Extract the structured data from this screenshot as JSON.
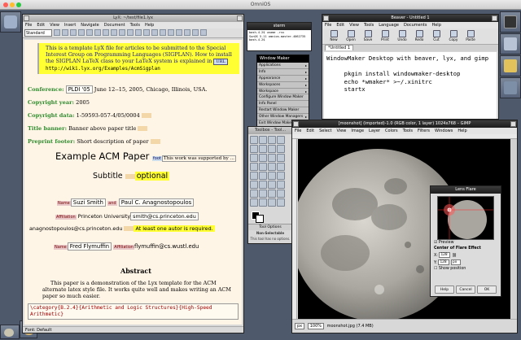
{
  "host": {
    "title": "OmniOS"
  },
  "lyx": {
    "title": "LyX: ~/test/file1.lyx",
    "menu": [
      "File",
      "Edit",
      "View",
      "Insert",
      "Navigate",
      "Document",
      "Tools",
      "Help"
    ],
    "style_select": "Standard",
    "ert_text": "This is a template LyX file for articles to be submitted to the Special Interest Group on Programming Languages (SIGPLAN). How to install the SIGPLAN LaTeX class to your LaTeX system is explained in",
    "url_label": "URL",
    "url": "http://wiki.lyx.org/Examples/AcmSigplan",
    "conference_label": "Conference:",
    "conference_name": "PLDI '05",
    "conference_value": "June 12--15, 2005, Chicago, Illinois, USA.",
    "copyright_year_label": "Copyright year:",
    "copyright_year": "2005",
    "copyright_data_label": "Copyright data:",
    "copyright_data": "1-59593-057-4/05/0004",
    "title_banner_label": "Title banner:",
    "title_banner": "Banner above paper title",
    "preprint_label": "Preprint footer:",
    "preprint": "Short description of paper",
    "paper_title": "Example ACM Paper",
    "foot_label": "foot",
    "foot_text": "This work was supported by ...",
    "subtitle": "Subtitle",
    "subtitle_optional": "optional",
    "name_label": "Name",
    "author1": "Suzi Smith",
    "and_label": "and",
    "author2": "Paul C. Anagnostopoulos",
    "affiliation_label": "Affiliation",
    "affiliation1": "Princeton University",
    "email1": "smith@cs.princeton.edu",
    "email2": "anagnostopoulos@cs.princeton.edu",
    "author_warning": "At least one autor is required.",
    "author3": "Fred Flymuffin",
    "email3": "flymuffin@cs.wustl.edu",
    "abstract_heading": "Abstract",
    "abstract_text": "This paper is a demonstration of the Lyx template for the ACM alternate latex style file. It works quite well and makes writing an ACM paper so much easier.",
    "category_code": "\\category{B.2.4}{Arithmetic and Logic Structures}{High-Speed Arithmetic}",
    "status": "Font: Default"
  },
  "sterm": {
    "title": "sterm",
    "lines": [
      "bash-4.2$ uname -rsv",
      "SunOS 5.11 omnios-master-4062735",
      "bash-4.2$ "
    ]
  },
  "wmmenu": {
    "title": "Window Maker",
    "items": [
      "Applications",
      "Info",
      "Appearance",
      "Workspaces",
      "Workspace",
      "Configure Window Maker",
      "Info Panel",
      "Restart Window Maker",
      "Other Window Managers",
      "Exit Window Maker"
    ]
  },
  "beaver": {
    "title": "Beaver - Untitled 1",
    "menu": [
      "File",
      "Edit",
      "View",
      "Tools",
      "Language",
      "Documents",
      "Help"
    ],
    "buttons": [
      "New",
      "Open",
      "Save",
      "Print",
      "Undo",
      "Redo",
      "Cut",
      "Copy",
      "Paste"
    ],
    "tab": "*Untitled 1",
    "content": "WindowMaker Desktop with beaver, lyx, and gimp\n\n     pkgin install windowmaker-desktop\n     echo *wmaker* >~/.xinitrc\n     startx"
  },
  "toolbox": {
    "title": "Toolbox - Tool...",
    "options_label": "Tool Options",
    "nosel_title": "Non-Selectable",
    "nosel_text": "This tool has no options."
  },
  "gimp": {
    "title": "[moonshot] (imported)-1.0 (RGB color, 1 layer) 1024x768 – GIMP",
    "menu": [
      "File",
      "Edit",
      "Select",
      "View",
      "Image",
      "Layer",
      "Colors",
      "Tools",
      "Filters",
      "Windows",
      "Help"
    ],
    "unit": "px",
    "zoom": "100%",
    "status": "moonshot.jpg (7.4 MB)"
  },
  "lensflare": {
    "title": "Lens Flare",
    "preview_label": "Preview",
    "center_label": "Center of Flare Effect",
    "x_label": "X:",
    "x_value": "128",
    "y_label": "Y:",
    "y_value": "128",
    "unit": "px",
    "show_position": "Show position",
    "help": "Help",
    "cancel": "Cancel",
    "ok": "OK"
  }
}
